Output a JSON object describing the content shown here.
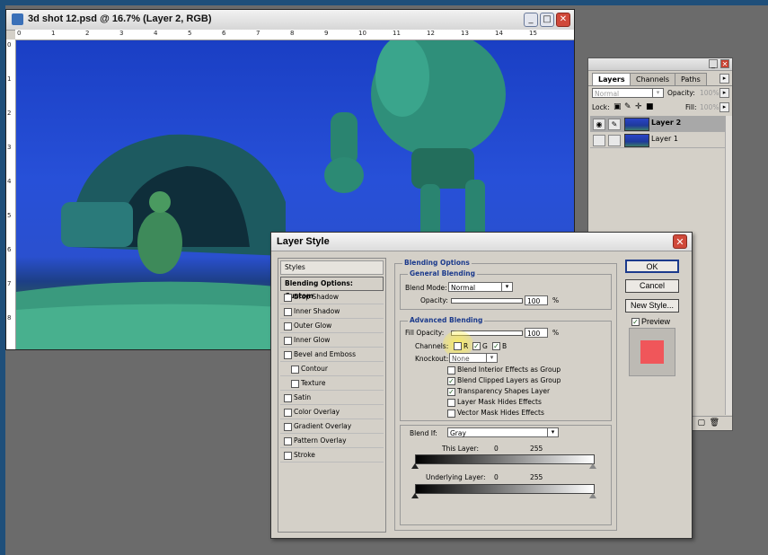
{
  "document": {
    "title": "3d shot 12.psd @ 16.7% (Layer 2, RGB)",
    "ruler_h": [
      "0",
      "1",
      "2",
      "3",
      "4",
      "5",
      "6",
      "7",
      "8",
      "9",
      "10",
      "11",
      "12",
      "13",
      "14",
      "15"
    ],
    "ruler_v": [
      "0",
      "1",
      "2",
      "3",
      "4",
      "5",
      "6",
      "7",
      "8",
      "9"
    ]
  },
  "layers_panel": {
    "tabs": [
      "Layers",
      "Channels",
      "Paths"
    ],
    "blend_mode": "Normal",
    "opacity_label": "Opacity:",
    "opacity_value": "100%",
    "lock_label": "Lock:",
    "fill_label": "Fill:",
    "fill_value": "100%",
    "layers": [
      {
        "name": "Layer 2",
        "selected": true
      },
      {
        "name": "Layer 1",
        "selected": false
      }
    ]
  },
  "dialog": {
    "title": "Layer Style",
    "styles_header": "Styles",
    "styles": [
      {
        "label": "Blending Options: Custom",
        "checkbox": false,
        "selected": true
      },
      {
        "label": "Drop Shadow",
        "checkbox": true,
        "checked": false
      },
      {
        "label": "Inner Shadow",
        "checkbox": true,
        "checked": false
      },
      {
        "label": "Outer Glow",
        "checkbox": true,
        "checked": false
      },
      {
        "label": "Inner Glow",
        "checkbox": true,
        "checked": false
      },
      {
        "label": "Bevel and Emboss",
        "checkbox": true,
        "checked": false
      },
      {
        "label": "Contour",
        "checkbox": true,
        "checked": false,
        "indent": true
      },
      {
        "label": "Texture",
        "checkbox": true,
        "checked": false,
        "indent": true
      },
      {
        "label": "Satin",
        "checkbox": true,
        "checked": false
      },
      {
        "label": "Color Overlay",
        "checkbox": true,
        "checked": false
      },
      {
        "label": "Gradient Overlay",
        "checkbox": true,
        "checked": false
      },
      {
        "label": "Pattern Overlay",
        "checkbox": true,
        "checked": false
      },
      {
        "label": "Stroke",
        "checkbox": true,
        "checked": false
      }
    ],
    "blending_options_title": "Blending Options",
    "general_blending_title": "General Blending",
    "blend_mode_label": "Blend Mode:",
    "blend_mode_value": "Normal",
    "opacity_label": "Opacity:",
    "opacity_value": "100",
    "percent": "%",
    "advanced_blending_title": "Advanced Blending",
    "fill_opacity_label": "Fill Opacity:",
    "fill_opacity_value": "100",
    "channels_label": "Channels:",
    "channel_r": "R",
    "channel_g": "G",
    "channel_b": "B",
    "knockout_label": "Knockout:",
    "knockout_value": "None",
    "options": [
      {
        "label": "Blend Interior Effects as Group",
        "checked": false
      },
      {
        "label": "Blend Clipped Layers as Group",
        "checked": true
      },
      {
        "label": "Transparency Shapes Layer",
        "checked": true
      },
      {
        "label": "Layer Mask Hides Effects",
        "checked": false
      },
      {
        "label": "Vector Mask Hides Effects",
        "checked": false
      }
    ],
    "blend_if_label": "Blend If:",
    "blend_if_value": "Gray",
    "this_layer_label": "This Layer:",
    "this_layer_min": "0",
    "this_layer_max": "255",
    "underlying_label": "Underlying Layer:",
    "underlying_min": "0",
    "underlying_max": "255",
    "ok": "OK",
    "cancel": "Cancel",
    "new_style": "New Style...",
    "preview": "Preview",
    "preview_color": "#f0565a"
  }
}
